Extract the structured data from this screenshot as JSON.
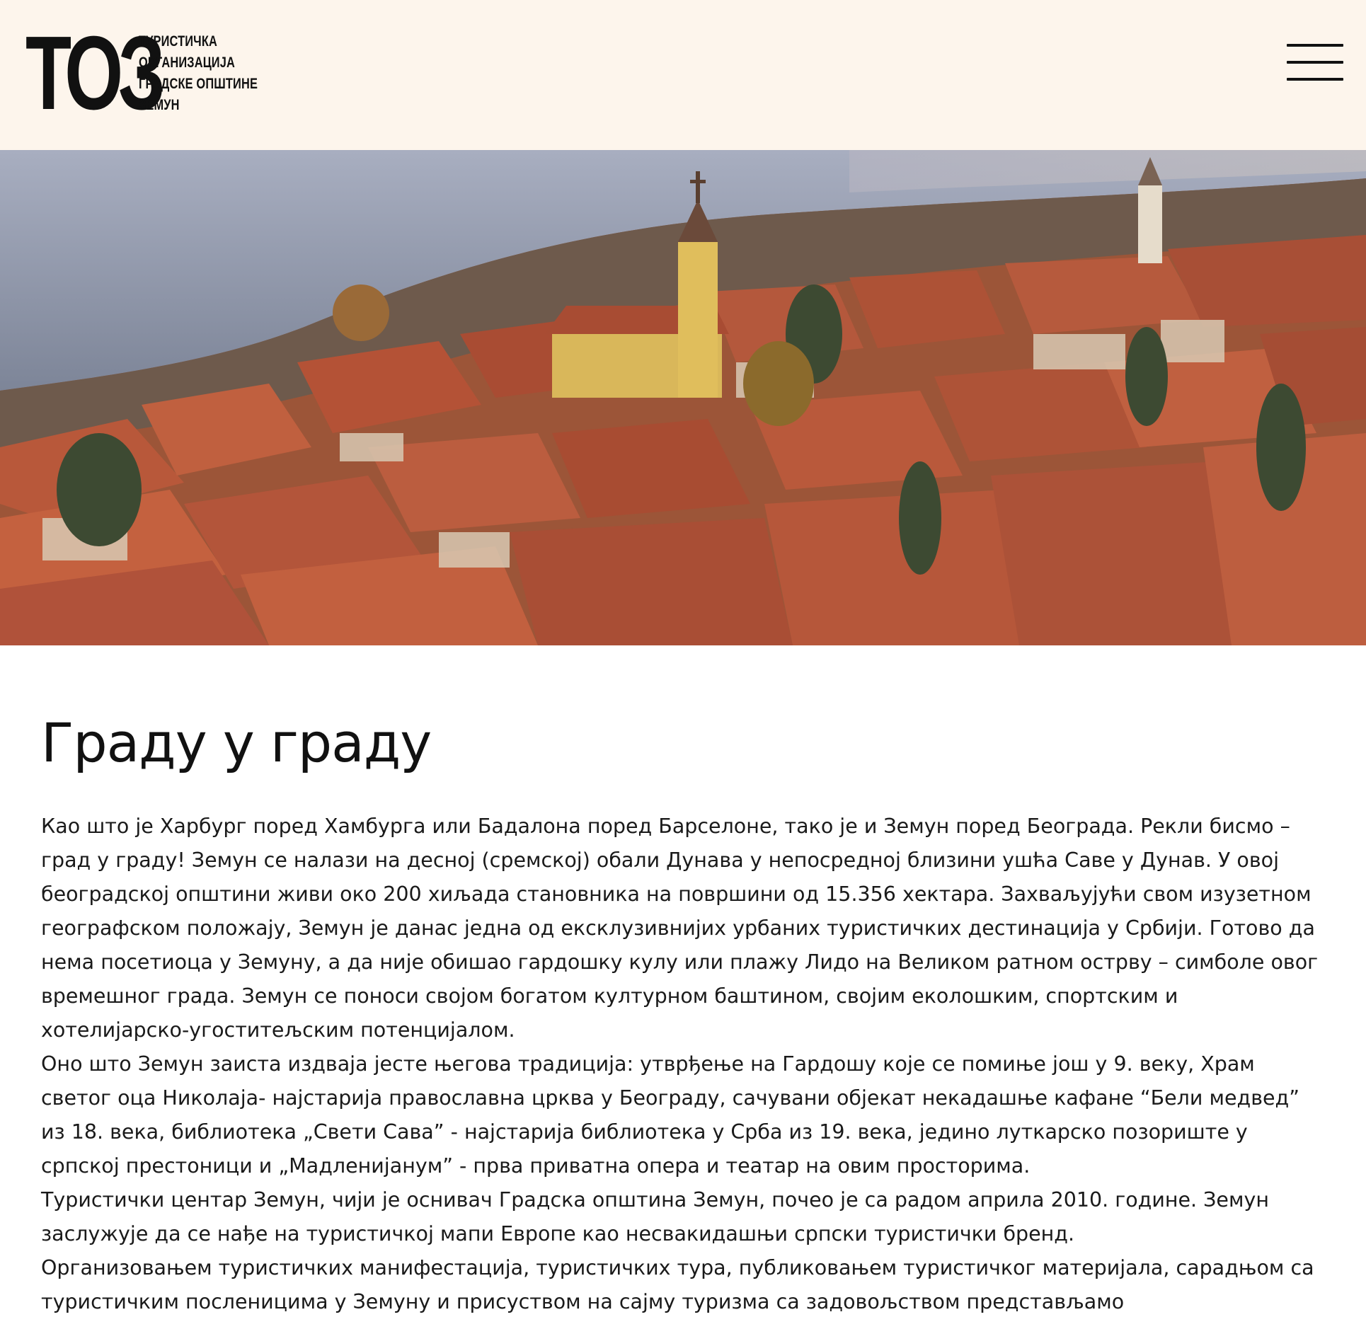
{
  "header": {
    "logo_mark": "ТОЗ",
    "logo_lines": [
      "ТУРИСТИЧКА",
      "ОРГАНИЗАЦИЈА",
      "ГРАДСКЕ ОПШТИНЕ",
      "ЗЕМУН"
    ],
    "menu_icon": "hamburger-menu-icon"
  },
  "hero": {
    "image": "aerial-view-of-zemun-rooftops-and-danube"
  },
  "main": {
    "title": "Граду у граду",
    "paragraphs": [
      "Као што је Харбург поред Хамбурга или Бадалона поред Барселоне, тако је и Земун поред Београда. Рекли бисмо – град у граду! Земун се налази на десној (сремској) обали Дунава у непосредној близини ушћа Саве у Дунав. У овој београдској општини живи око 200 хиљада становника на површини од 15.356 хектара. Захваљујући свом изузетном географском положају, Земун је данас једна од ексклузивнијих урбаних туристичких дестинација у Србији. Готово да нема посетиоца у Земуну, а да није обишао гардошку кулу или плажу Лидо на Великом ратном острву – симболе овог времешног града. Земун се поноси својом богатом културном баштином, својим еколошким, спортским и хотелијарско-угоститељским потенцијалом.",
      "Оно што Земун заиста издваја јесте његова традиција: утврђење на Гардошу које се помиње још у 9. веку, Храм светог оца Николаја- најстарија православна црква у Београду, сачувани објекат некадашње кафане “Бели медвед” из 18. века, библиотека „Свети Сава” - најстарија библиотека у Срба из 19. века, једино луткарско позориште у српској престоници и „Мадленијанум” - прва приватна опера и театар на овим просторима.",
      "Туристички центар Земун, чији је оснивач Градска општина Земун, почео је са радом априла 2010. године. Земун заслужује да се нађе на туристичкој мапи Европе као несвакидашњи српски туристички бренд.",
      "Организовањем туристичких манифестација, туристичких тура, публиковањем туристичког материјала, сарадњом са туристичким посленицима у Земуну и присуством на сајму туризма са задовољством представљамо"
    ]
  }
}
